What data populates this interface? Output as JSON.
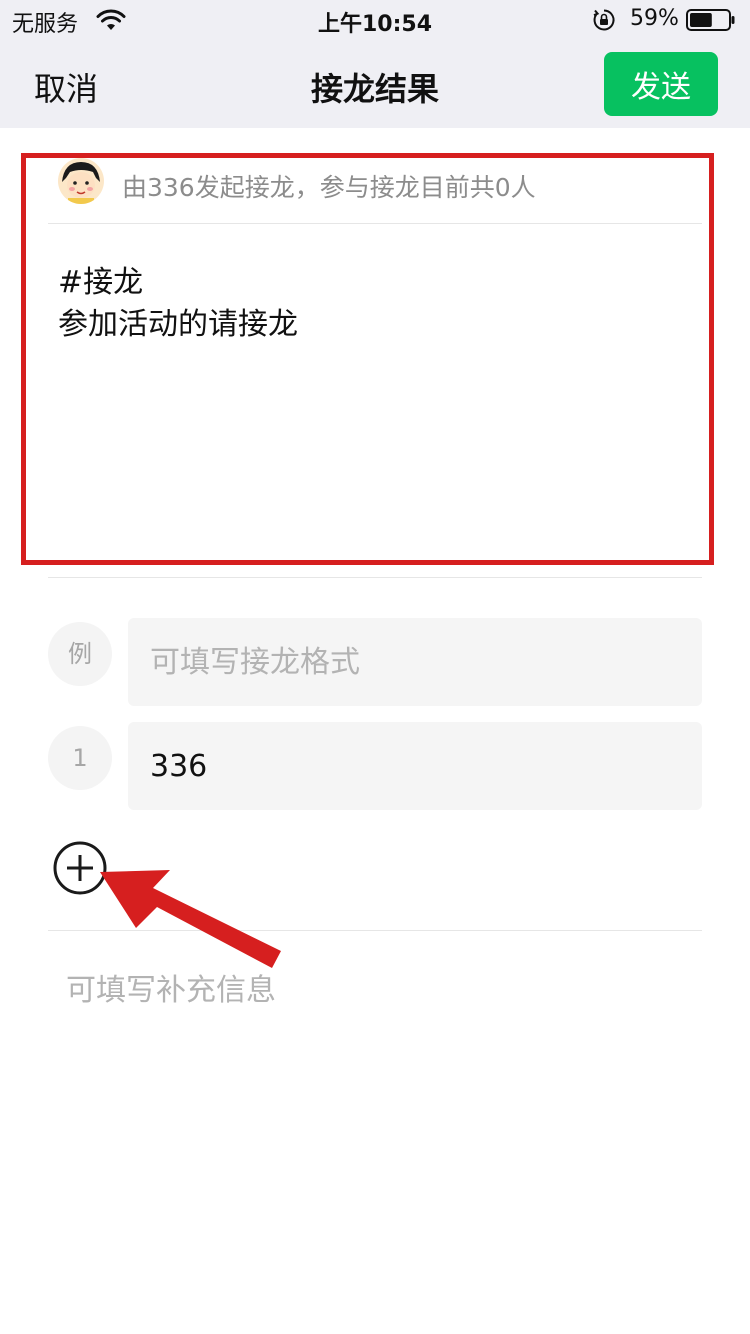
{
  "status_bar": {
    "carrier": "无服务",
    "time": "上午10:54",
    "battery_percent": "59%",
    "battery_level": 0.59,
    "icons": [
      "wifi-icon",
      "orientation-lock-icon",
      "battery-icon"
    ]
  },
  "nav": {
    "cancel_label": "取消",
    "title": "接龙结果",
    "send_label": "发送",
    "send_color": "#07c160"
  },
  "info": {
    "initiator_text": "由336发起接龙，参与接龙目前共0人"
  },
  "topic": {
    "text": "#接龙\n参加活动的请接龙"
  },
  "entries": [
    {
      "badge": "例",
      "value": "",
      "placeholder": "可填写接龙格式"
    },
    {
      "badge": "1",
      "value": "336",
      "placeholder": ""
    }
  ],
  "supplement": {
    "placeholder": "可填写补充信息"
  },
  "annotations": {
    "highlight_color": "#d61f1f"
  }
}
